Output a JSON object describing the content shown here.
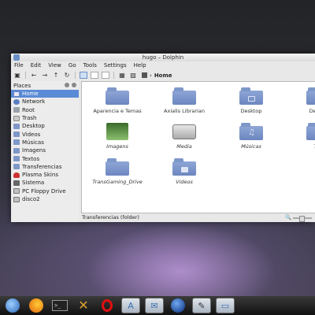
{
  "window": {
    "title": "hugo – Dolphin",
    "menu": [
      "File",
      "Edit",
      "View",
      "Go",
      "Tools",
      "Settings",
      "Help"
    ],
    "breadcrumb": "Home",
    "places_title": "Places",
    "places": [
      {
        "label": "Home",
        "icon": "home-icon",
        "selected": true
      },
      {
        "label": "Network",
        "icon": "network-icon"
      },
      {
        "label": "Root",
        "icon": "root-icon"
      },
      {
        "label": "Trash",
        "icon": "trash-icon"
      },
      {
        "label": "Desktop",
        "icon": "folder-icon"
      },
      {
        "label": "Videos",
        "icon": "folder-icon"
      },
      {
        "label": "Músicas",
        "icon": "folder-icon"
      },
      {
        "label": "Imagens",
        "icon": "folder-icon"
      },
      {
        "label": "Textos",
        "icon": "folder-icon"
      },
      {
        "label": "Transferencias",
        "icon": "folder-icon"
      },
      {
        "label": "Plasma Skins",
        "icon": "heart-icon"
      },
      {
        "label": "Sistema",
        "icon": "system-icon"
      },
      {
        "label": "PC Floppy Drive",
        "icon": "floppy-icon"
      },
      {
        "label": "disco2",
        "icon": "drive-icon"
      }
    ],
    "files": [
      {
        "label": "Aparencia e Temas",
        "type": "folder",
        "italic": false
      },
      {
        "label": "Axialis Librarian",
        "type": "folder",
        "italic": false
      },
      {
        "label": "Desktop",
        "type": "folder-desktop",
        "italic": false
      },
      {
        "label": "Develo",
        "type": "folder",
        "italic": false
      },
      {
        "label": "Imagens",
        "type": "images",
        "italic": true
      },
      {
        "label": "Media",
        "type": "drive",
        "italic": true
      },
      {
        "label": "Músicas",
        "type": "folder-music",
        "italic": true
      },
      {
        "label": "Tex",
        "type": "text",
        "italic": true
      },
      {
        "label": "TransGaming_Drive",
        "type": "folder",
        "italic": true
      },
      {
        "label": "Videos",
        "type": "folder-video",
        "italic": true
      }
    ],
    "status": "Transferencias (folder)"
  },
  "taskbar": {
    "items": [
      "globe-icon",
      "firefox-icon",
      "terminal-icon",
      "tools-icon",
      "opera-icon",
      "font-icon",
      "mail-icon",
      "earth-icon",
      "pen-icon",
      "folder-icon"
    ],
    "terminal_glyph": ">_"
  }
}
